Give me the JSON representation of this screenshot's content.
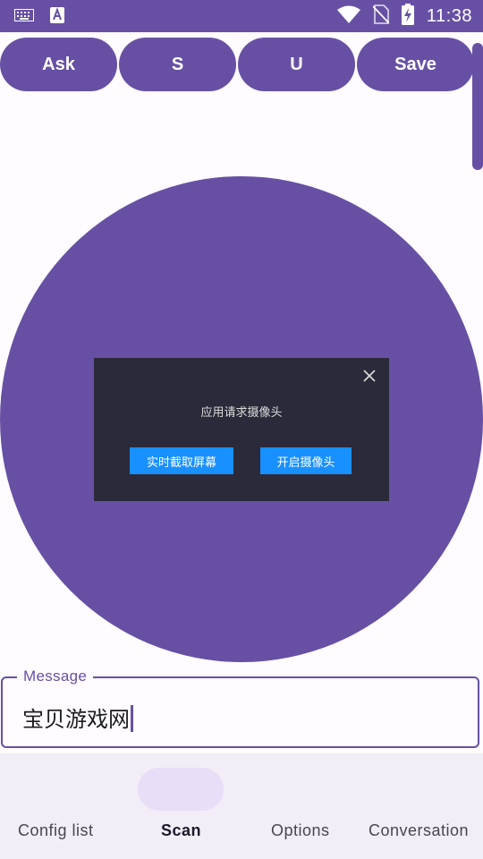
{
  "statusbar": {
    "time": "11:38",
    "icons": [
      "keyboard-icon",
      "text-a-icon",
      "wifi-icon",
      "no-sim-icon",
      "battery-charging-icon"
    ]
  },
  "toolbar": {
    "buttons": [
      "Ask",
      "S",
      "U",
      "Save"
    ]
  },
  "dialog": {
    "message": "应用请求摄像头",
    "button_screen": "实时截取屏幕",
    "button_camera": "开启摄像头"
  },
  "message_field": {
    "label": "Message",
    "value": "宝贝游戏网"
  },
  "nav": {
    "items": [
      "Config list",
      "Scan",
      "Options",
      "Conversation"
    ],
    "selected": "Scan"
  },
  "colors": {
    "primary": "#6750a4",
    "dialog_bg": "#2a2a3a",
    "dialog_button": "#1890ff",
    "nav_bg": "#f3edf7",
    "nav_indicator": "#e8def8"
  }
}
